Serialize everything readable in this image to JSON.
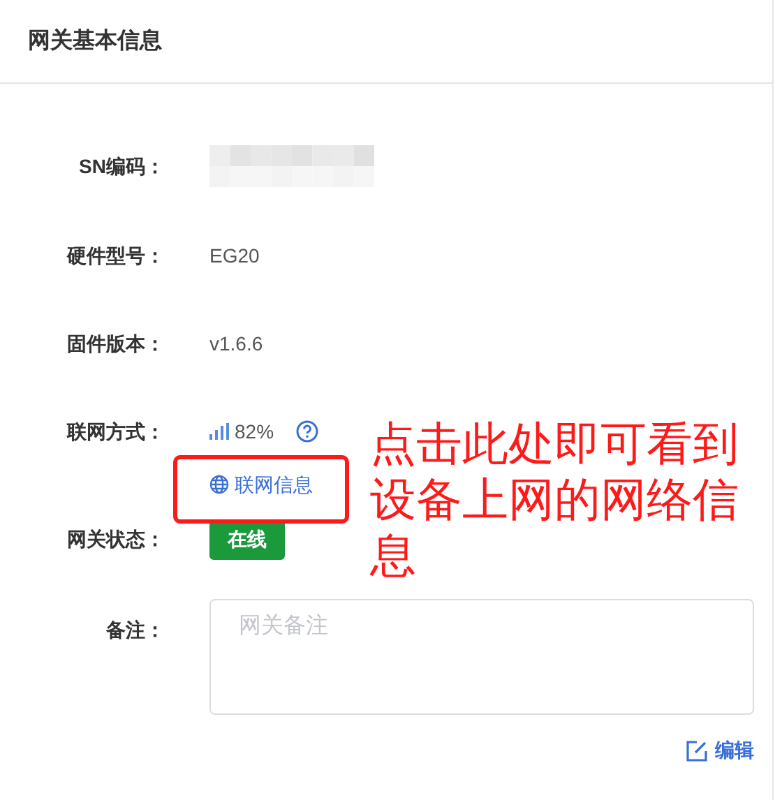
{
  "header": {
    "title": "网关基本信息"
  },
  "fields": [
    {
      "kind": "redacted",
      "label": "SN编码："
    },
    {
      "kind": "text",
      "label": "硬件型号：",
      "value": "EG20"
    },
    {
      "kind": "text",
      "label": "固件版本：",
      "value": "v1.6.6"
    },
    {
      "kind": "network",
      "label": "联网方式：",
      "signal": "82%",
      "link": "联网信息"
    },
    {
      "kind": "status",
      "label": "网关状态：",
      "status": "在线"
    },
    {
      "kind": "textarea",
      "label": "备注：",
      "placeholder": "网关备注"
    }
  ],
  "edit_button": "编辑",
  "annotation": {
    "text": "点击此处即可看到设备上网的网络信息"
  }
}
